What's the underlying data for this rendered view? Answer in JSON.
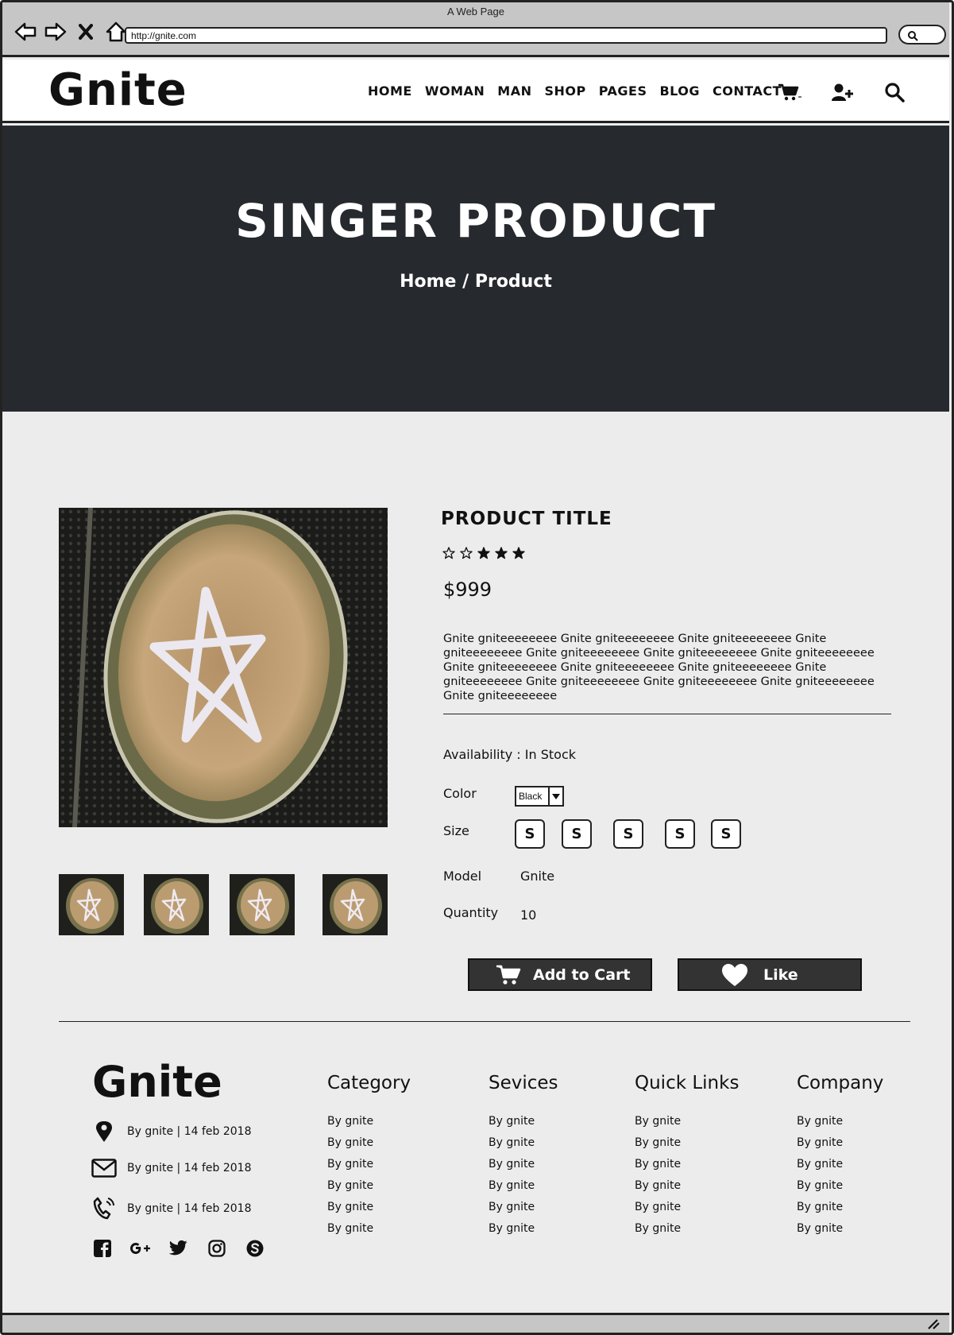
{
  "browser": {
    "title": "A Web Page",
    "url": "http://gnite.com"
  },
  "header": {
    "logo": "Gnite",
    "nav": [
      "HOME",
      "WOMAN",
      "MAN",
      "SHOP",
      "PAGES",
      "BLOG",
      "CONTACT"
    ],
    "icons": [
      "cart-icon",
      "add-user-icon",
      "search-icon"
    ]
  },
  "hero": {
    "title": "SINGER PRODUCT",
    "breadcrumb_home": "Home",
    "breadcrumb_sep": "/",
    "breadcrumb_current": "Product"
  },
  "product": {
    "title": "PRODUCT TITLE",
    "rating": 3,
    "rating_max": 5,
    "price": "$999",
    "description": "Gnite gniteeeeeeee Gnite gniteeeeeeee Gnite gniteeeeeeee Gnite gniteeeeeeee Gnite gniteeeeeeee  Gnite gniteeeeeeee Gnite gniteeeeeeee Gnite gniteeeeeeee Gnite gniteeeeeeee Gnite gniteeeeeeee  Gnite gniteeeeeeee Gnite gniteeeeeeee Gnite gniteeeeeeee Gnite gniteeeeeeee Gnite gniteeeeeeee",
    "availability_label": "Availability : In Stock",
    "color_label": "Color",
    "color_value": "Black",
    "size_label": "Size",
    "sizes": [
      "S",
      "S",
      "S",
      "S",
      "S"
    ],
    "model_label": "Model",
    "model_value": "Gnite",
    "quantity_label": "Quantity",
    "quantity_value": "10",
    "add_to_cart": "Add to Cart",
    "like": "Like"
  },
  "footer": {
    "logo": "Gnite",
    "contacts": [
      {
        "icon": "location-pin-icon",
        "text": "By gnite | 14 feb 2018"
      },
      {
        "icon": "envelope-icon",
        "text": "By gnite | 14 feb 2018"
      },
      {
        "icon": "phone-icon",
        "text": "By gnite | 14 feb 2018"
      }
    ],
    "socials": [
      "facebook-icon",
      "google-plus-icon",
      "twitter-icon",
      "instagram-icon",
      "skype-icon"
    ],
    "columns": [
      {
        "title": "Category",
        "links": [
          "By gnite",
          "By gnite",
          "By gnite",
          "By gnite",
          "By gnite",
          "By gnite"
        ]
      },
      {
        "title": "Sevices",
        "links": [
          "By gnite",
          "By gnite",
          "By gnite",
          "By gnite",
          "By gnite",
          "By gnite"
        ]
      },
      {
        "title": "Quick Links",
        "links": [
          "By gnite",
          "By gnite",
          "By gnite",
          "By gnite",
          "By gnite",
          "By gnite"
        ]
      },
      {
        "title": "Company",
        "links": [
          "By gnite",
          "By gnite",
          "By gnite",
          "By gnite",
          "By gnite",
          "By gnite"
        ]
      }
    ]
  },
  "colors": {
    "hero_bg": "#262a2e",
    "page_bg": "#ececec",
    "chrome_bg": "#c6c6c6",
    "button_bg": "#333333"
  }
}
